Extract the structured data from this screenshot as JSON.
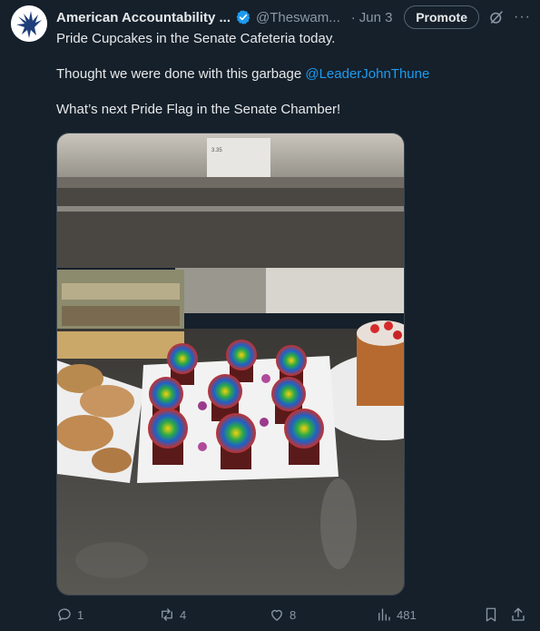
{
  "author": {
    "name": "American Accountability ...",
    "handle": "@Theswam...",
    "date": "Jun 3"
  },
  "header": {
    "promote_label": "Promote"
  },
  "tweet": {
    "line1": "Pride Cupcakes in the Senate Cafeteria today.",
    "line2_text": "Thought we were done with this garbage ",
    "line2_mention": "@LeaderJohnThune",
    "line3": "What’s next Pride Flag in the Senate Chamber!"
  },
  "media": {
    "price_tag": "3.35"
  },
  "actions": {
    "replies": "1",
    "reposts": "4",
    "likes": "8",
    "views": "481"
  },
  "colors": {
    "background": "#15202b",
    "accent": "#1d9bf0",
    "muted": "#8b98a5"
  },
  "icons": [
    "eagle-logo",
    "verified-badge-icon",
    "grok-icon",
    "more-icon",
    "reply-icon",
    "repost-icon",
    "like-icon",
    "views-icon",
    "bookmark-icon",
    "share-icon"
  ]
}
